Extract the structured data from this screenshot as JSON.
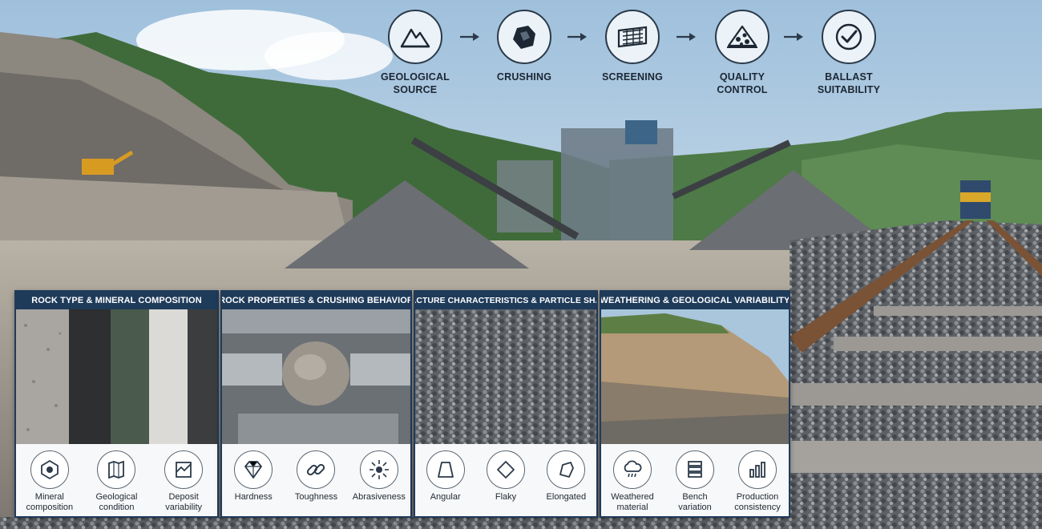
{
  "process": {
    "steps": [
      {
        "label": "GEOLOGICAL\nSOURCE",
        "icon": "mountain-icon"
      },
      {
        "label": "CRUSHING",
        "icon": "rock-icon"
      },
      {
        "label": "SCREENING",
        "icon": "screen-icon"
      },
      {
        "label": "QUALITY\nCONTROL",
        "icon": "stone-pile-icon"
      },
      {
        "label": "BALLAST\nSUITABILITY",
        "icon": "checkmark-icon"
      }
    ]
  },
  "panels": [
    {
      "title": "ROCK TYPE & MINERAL COMPOSITION",
      "items": [
        {
          "label": "Mineral\ncomposition",
          "icon": "mineral-icon"
        },
        {
          "label": "Geological\ncondition",
          "icon": "map-icon"
        },
        {
          "label": "Deposit\nvariability",
          "icon": "deposit-icon"
        }
      ]
    },
    {
      "title": "ROCK PROPERTIES & CRUSHING BEHAVIOR",
      "items": [
        {
          "label": "Hardness",
          "icon": "diamond-icon"
        },
        {
          "label": "Toughness",
          "icon": "chain-link-icon"
        },
        {
          "label": "Abrasiveness",
          "icon": "burst-icon"
        }
      ]
    },
    {
      "title": "FRACTURE CHARACTERISTICS & PARTICLE SHAPE",
      "items": [
        {
          "label": "Angular",
          "icon": "angular-shape-icon"
        },
        {
          "label": "Flaky",
          "icon": "flaky-shape-icon"
        },
        {
          "label": "Elongated",
          "icon": "elongated-shape-icon"
        }
      ]
    },
    {
      "title": "WEATHERING & GEOLOGICAL VARIABILITY",
      "items": [
        {
          "label": "Weathered\nmaterial",
          "icon": "rain-cloud-icon"
        },
        {
          "label": "Bench\nvariation",
          "icon": "layers-icon"
        },
        {
          "label": "Production\nconsistency",
          "icon": "bar-chart-icon"
        }
      ]
    }
  ],
  "colors": {
    "panel_header": "#1f3b5a",
    "icon_stroke": "#2b3a4a"
  }
}
